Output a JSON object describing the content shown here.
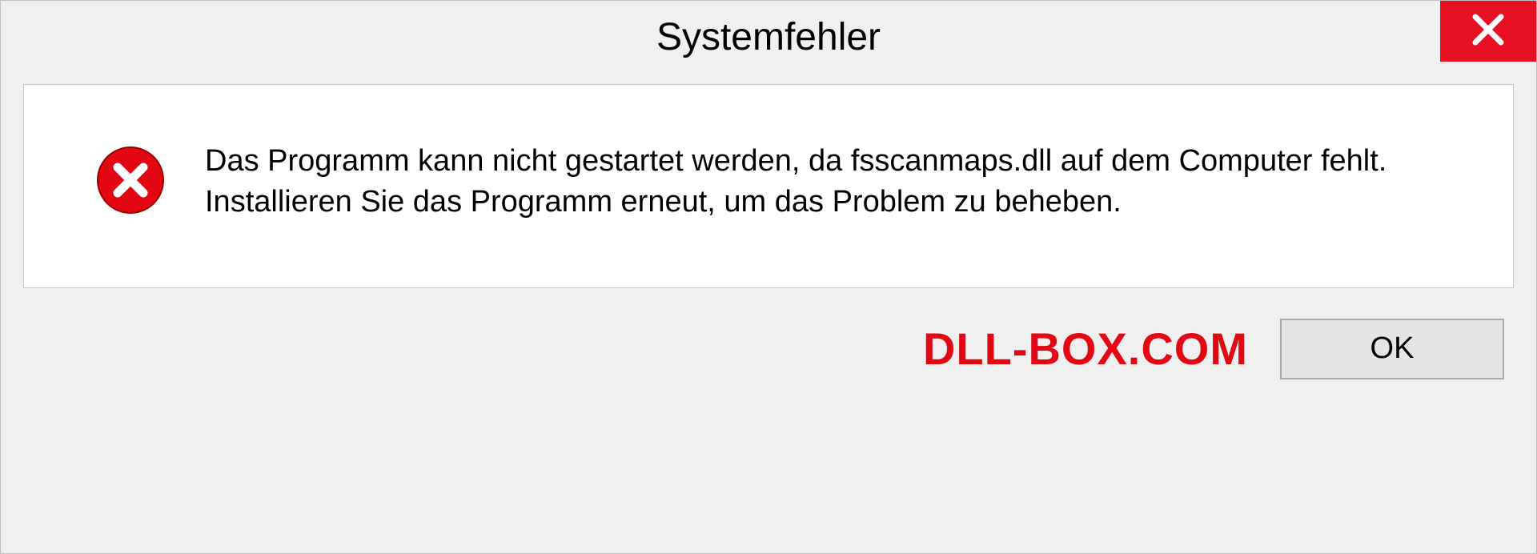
{
  "dialog": {
    "title": "Systemfehler",
    "message": "Das Programm kann nicht gestartet werden, da fsscanmaps.dll auf dem Computer fehlt. Installieren Sie das Programm erneut, um das Problem zu beheben.",
    "ok_label": "OK"
  },
  "watermark": "DLL-BOX.COM",
  "colors": {
    "close_bg": "#e81123",
    "watermark": "#e30613"
  }
}
